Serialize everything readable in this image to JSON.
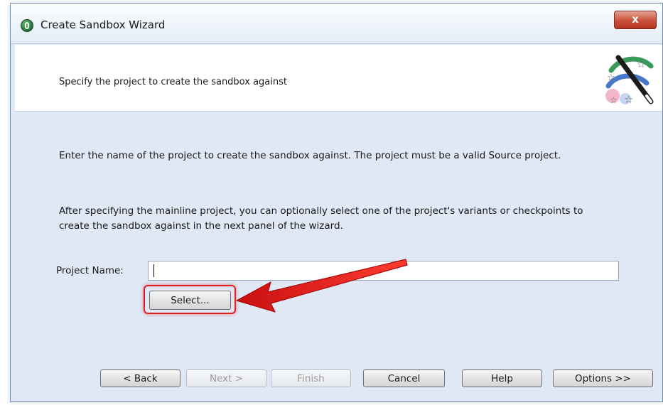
{
  "window": {
    "title": "Create Sandbox Wizard",
    "close_label": "x"
  },
  "header": {
    "text": "Specify the project to create the sandbox against",
    "illustration_icon": "magic-wand-stars-icon"
  },
  "content": {
    "paragraph1": "Enter the name of the project to create the sandbox against.  The project must be a valid Source project.",
    "paragraph2": "After specifying the mainline project, you can optionally select one of the project's variants or checkpoints to create the sandbox against in the next panel of the wizard.",
    "project_name_label": "Project Name:",
    "project_name_value": "",
    "select_button": "Select..."
  },
  "buttons": {
    "back": "< Back",
    "next": "Next >",
    "finish": "Finish",
    "cancel": "Cancel",
    "help": "Help",
    "options": "Options >>"
  },
  "annotation": {
    "color": "#e02020"
  }
}
